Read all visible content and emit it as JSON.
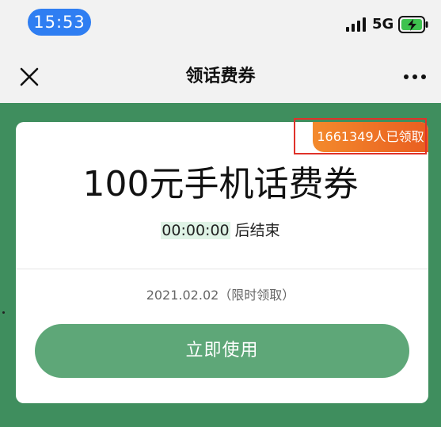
{
  "status_bar": {
    "time": "15:53",
    "network": "5G",
    "signal_icon": "cellular-signal-icon",
    "battery_icon": "battery-charging-icon"
  },
  "nav": {
    "title": "领话费券",
    "close_icon": "close-icon",
    "more_icon": "more-dots-icon"
  },
  "coupon": {
    "claimed_count": "1661349人已领取",
    "title": "100元手机话费券",
    "countdown": "00:00:00",
    "countdown_suffix": " 后结束",
    "date_note": "2021.02.02（限时领取）",
    "button_label": "立即使用"
  },
  "colors": {
    "time_pill": "#2f7ef2",
    "green_background": "#3f8e5e",
    "button_green": "#5ea778",
    "badge_orange": "#ee7426",
    "highlight_frame": "#e0322a"
  }
}
